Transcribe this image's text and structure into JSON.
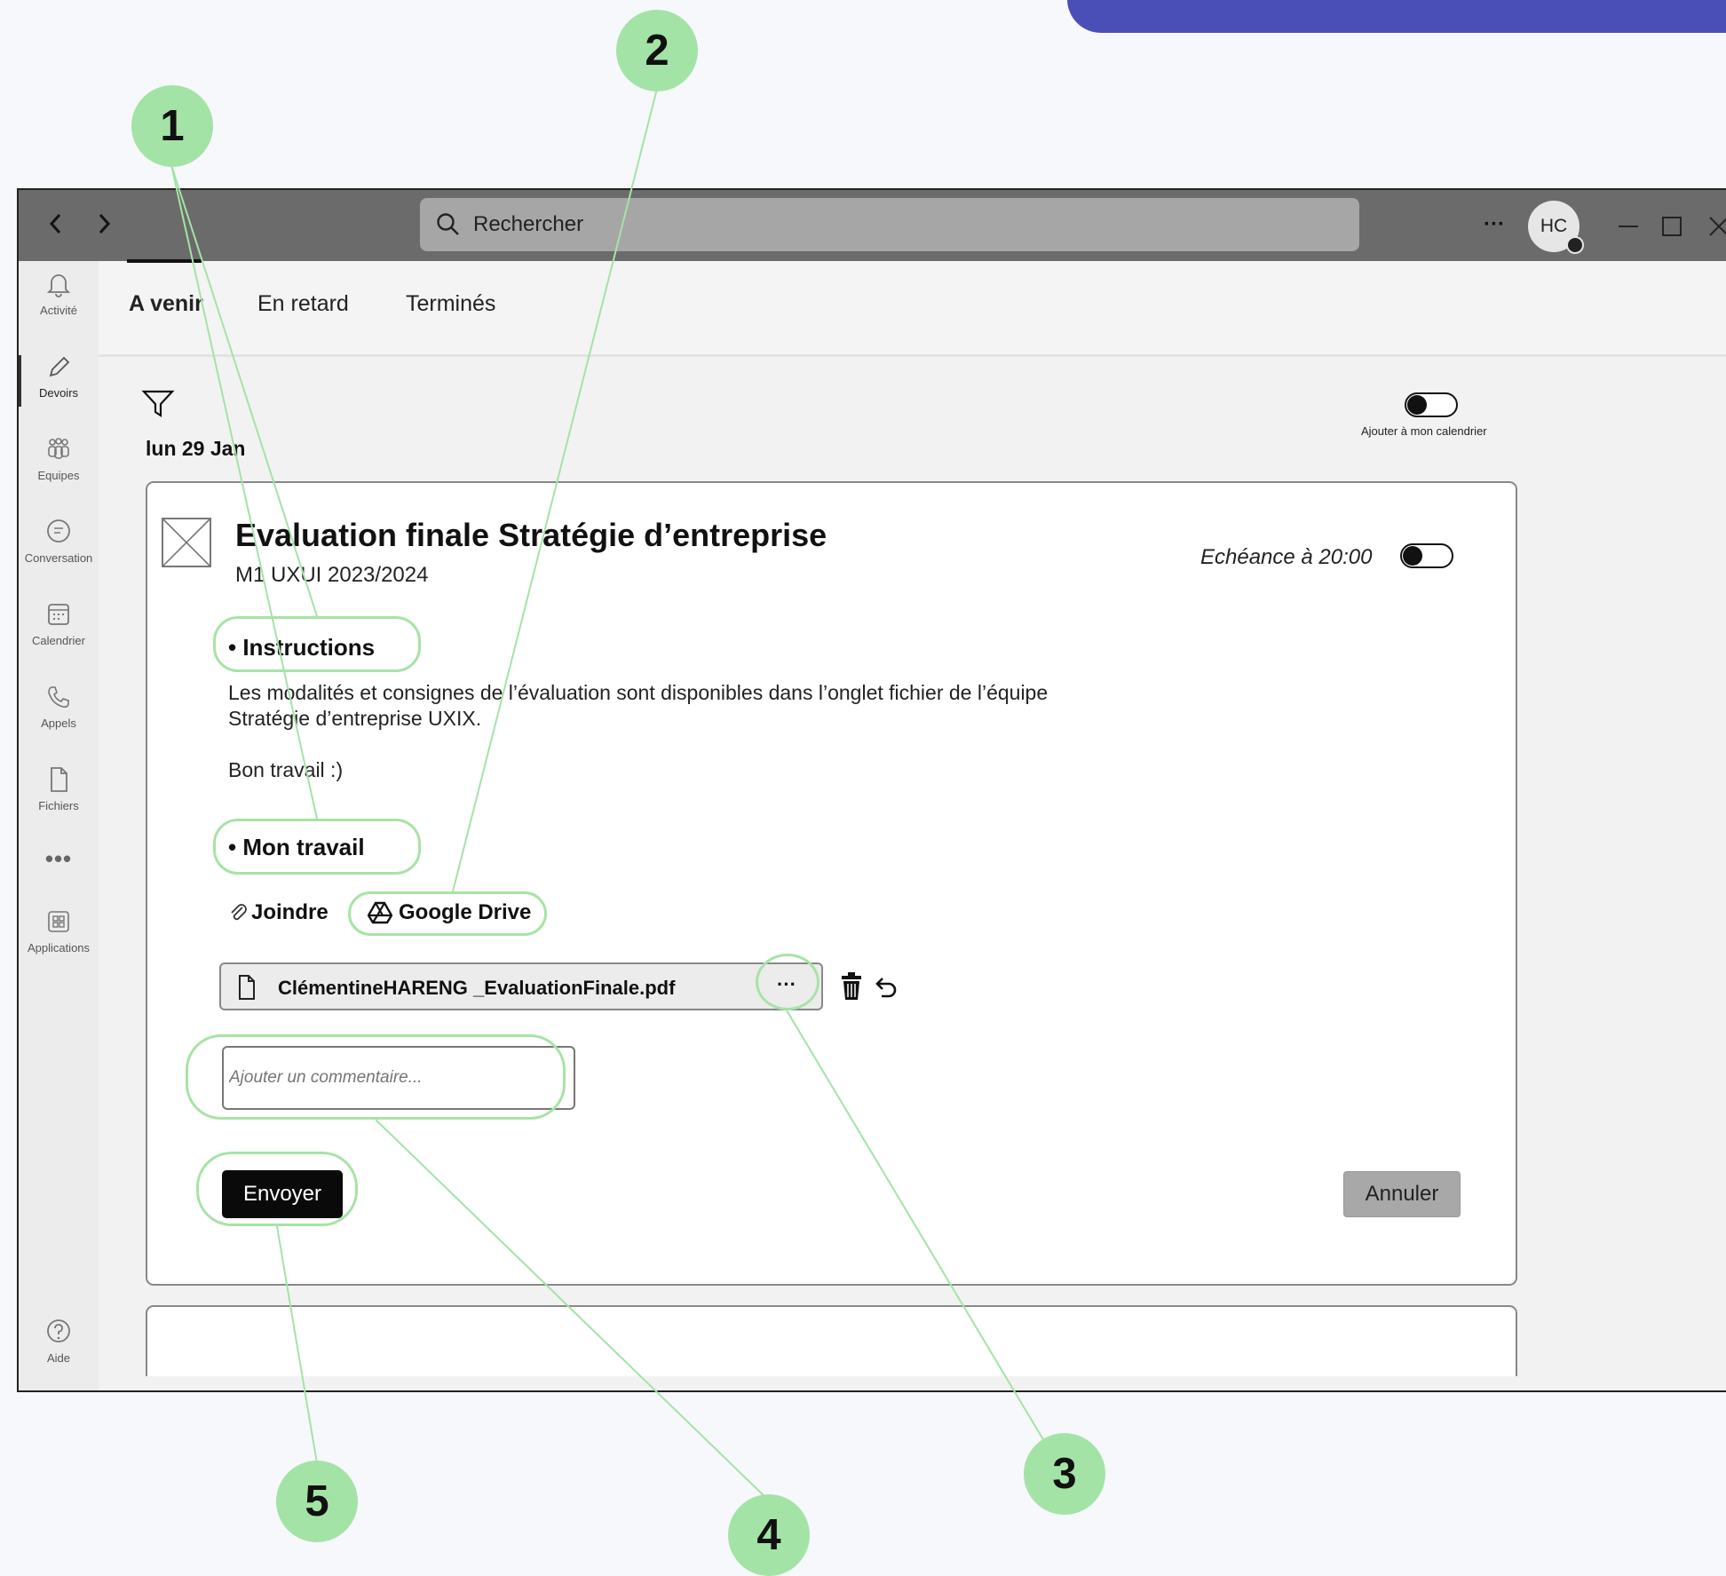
{
  "window": {
    "search_placeholder": "Rechercher",
    "avatar_initials": "HC",
    "more_label": "···"
  },
  "sidebar": {
    "items": [
      {
        "label": "Activité",
        "icon": "bell-icon"
      },
      {
        "label": "Devoirs",
        "icon": "pencil-icon"
      },
      {
        "label": "Equipes",
        "icon": "people-icon"
      },
      {
        "label": "Conversation",
        "icon": "chat-icon"
      },
      {
        "label": "Calendrier",
        "icon": "calendar-icon"
      },
      {
        "label": "Appels",
        "icon": "phone-icon"
      },
      {
        "label": "Fichiers",
        "icon": "file-icon"
      },
      {
        "label": "•••",
        "icon": "more-icon"
      },
      {
        "label": "Applications",
        "icon": "apps-icon"
      }
    ],
    "help_label": "Aide"
  },
  "tabs": [
    {
      "label": "A venir",
      "active": true
    },
    {
      "label": "En retard",
      "active": false
    },
    {
      "label": "Terminés",
      "active": false
    }
  ],
  "calendar_toggle_label": "Ajouter à mon calendrier",
  "date_label": "lun 29 Jan",
  "assignment": {
    "title": "Evaluation finale Stratégie d’entreprise",
    "subtitle": "M1 UXUI 2023/2024",
    "due_label": "Echéance à 20:00",
    "instructions_heading": "• Instructions",
    "instructions_line1": "Les modalités et consignes de l’évaluation sont disponibles dans l’onglet fichier de l’équipe",
    "instructions_line2": "Stratégie d’entreprise UXIX.",
    "instructions_line3": "Bon travail :)",
    "work_heading": "• Mon travail",
    "attach_label": "Joindre",
    "drive_label": "Google Drive",
    "file_name": "ClémentineHARENG _EvaluationFinale.pdf",
    "file_more": "···",
    "comment_placeholder": "Ajouter un commentaire...",
    "send_label": "Envoyer",
    "cancel_label": "Annuler"
  },
  "annotations": [
    "1",
    "2",
    "3",
    "4",
    "5"
  ],
  "colors": {
    "annotation_green": "#a4e3a6",
    "titlebar": "#6b6b6b",
    "banner": "#4a4fb8"
  }
}
